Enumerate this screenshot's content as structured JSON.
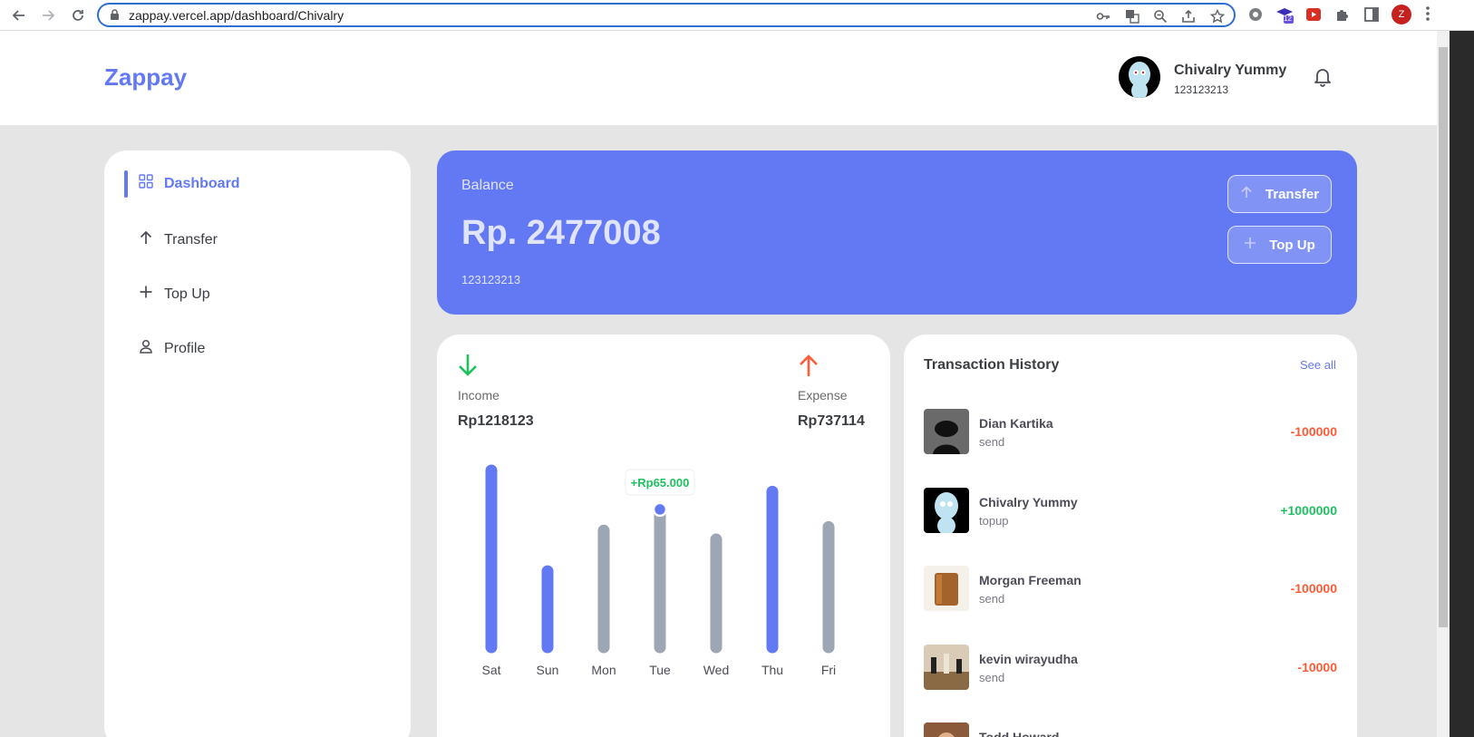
{
  "browser": {
    "url": "zappay.vercel.app/dashboard/Chivalry",
    "profile_initial": "Z",
    "extension_badge": "12"
  },
  "header": {
    "logo": "Zappay",
    "user_name": "Chivalry Yummy",
    "user_phone": "123123213"
  },
  "sidebar": {
    "items": [
      {
        "label": "Dashboard",
        "icon": "grid-icon",
        "active": true
      },
      {
        "label": "Transfer",
        "icon": "arrow-up-icon"
      },
      {
        "label": "Top Up",
        "icon": "plus-icon"
      },
      {
        "label": "Profile",
        "icon": "user-icon"
      }
    ]
  },
  "balance": {
    "label": "Balance",
    "amount": "Rp. 2477008",
    "phone": "123123213",
    "transfer_label": "Transfer",
    "topup_label": "Top Up"
  },
  "summary": {
    "income_label": "Income",
    "income_value": "Rp1218123",
    "expense_label": "Expense",
    "expense_value": "Rp737114"
  },
  "chart_data": {
    "type": "bar",
    "categories": [
      "Sat",
      "Sun",
      "Mon",
      "Tue",
      "Wed",
      "Thu",
      "Fri"
    ],
    "values": [
      100,
      43,
      66,
      78,
      61,
      88,
      68
    ],
    "bar_colors": [
      "#6379f4",
      "#6379f4",
      "#9da6b5",
      "#9da6b5",
      "#9da6b5",
      "#6379f4",
      "#9da6b5"
    ],
    "tooltip": {
      "category": "Tue",
      "label": "+Rp65.000"
    }
  },
  "transactions": {
    "title": "Transaction History",
    "see_all": "See all",
    "items": [
      {
        "name": "Dian Kartika",
        "type": "send",
        "amount": "-100000",
        "color": "#ff5b37"
      },
      {
        "name": "Chivalry Yummy",
        "type": "topup",
        "amount": "+1000000",
        "color": "#1ec15f"
      },
      {
        "name": "Morgan Freeman",
        "type": "send",
        "amount": "-100000",
        "color": "#ff5b37"
      },
      {
        "name": "kevin wirayudha",
        "type": "send",
        "amount": "-10000",
        "color": "#ff5b37"
      },
      {
        "name": "Todd Howard",
        "type": "",
        "amount": "",
        "color": "#ff5b37"
      }
    ]
  },
  "colors": {
    "primary": "#6379f4",
    "income": "#1ec15f",
    "expense": "#ff5b37"
  }
}
